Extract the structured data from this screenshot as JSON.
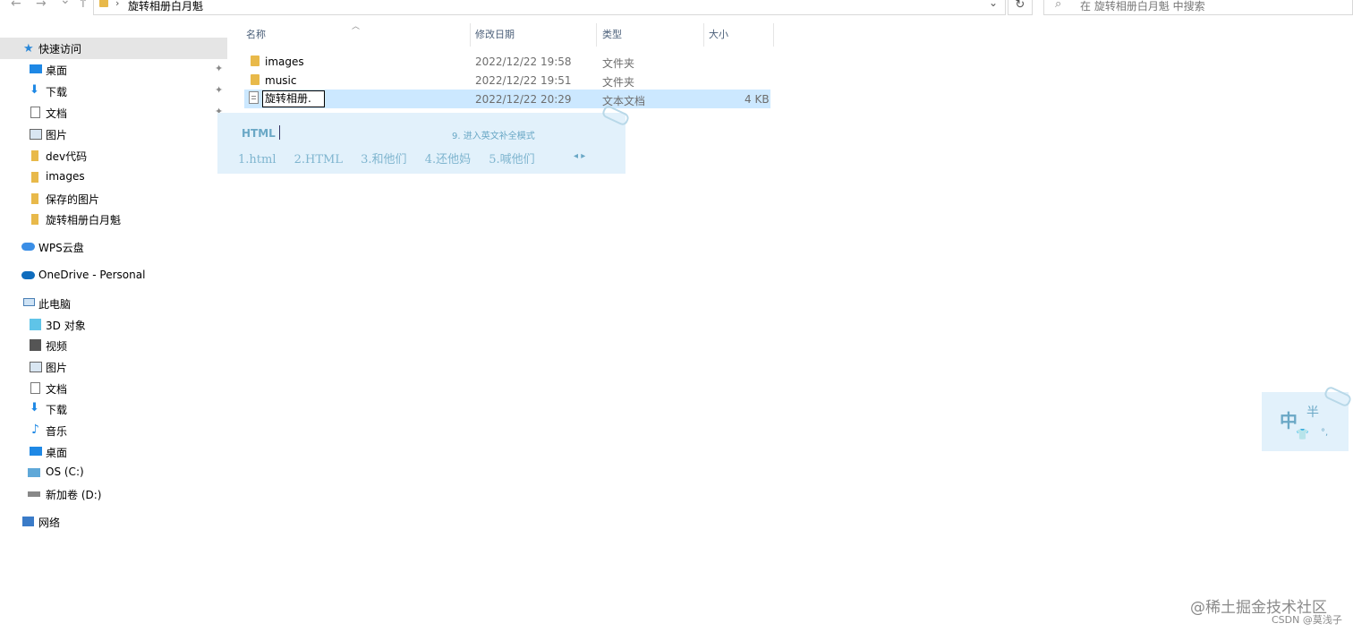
{
  "nav": {
    "back": "←",
    "forward": "→",
    "recent": "⌄",
    "up": "↑"
  },
  "address": {
    "separator": "›",
    "path": "旋转相册白月魁",
    "dropdown": "⌄",
    "refresh": "↻"
  },
  "search": {
    "icon": "search-icon",
    "placeholder": "在 旋转相册白月魁 中搜索"
  },
  "sidebar": {
    "quick_access": {
      "label": "快速访问",
      "items": [
        {
          "label": "桌面",
          "icon": "desktop-icon",
          "pinned": true
        },
        {
          "label": "下载",
          "icon": "download-icon",
          "pinned": true
        },
        {
          "label": "文档",
          "icon": "documents-icon",
          "pinned": true
        },
        {
          "label": "图片",
          "icon": "pictures-icon",
          "pinned": true
        },
        {
          "label": "dev代码",
          "icon": "folder-icon"
        },
        {
          "label": "images",
          "icon": "folder-icon"
        },
        {
          "label": "保存的图片",
          "icon": "folder-icon"
        },
        {
          "label": "旋转相册白月魁",
          "icon": "folder-icon"
        }
      ]
    },
    "wps": {
      "label": "WPS云盘",
      "icon": "cloud-icon"
    },
    "onedrive": {
      "label": "OneDrive - Personal",
      "icon": "onedrive-icon"
    },
    "this_pc": {
      "label": "此电脑",
      "items": [
        {
          "label": "3D 对象",
          "icon": "3d-objects-icon"
        },
        {
          "label": "视频",
          "icon": "videos-icon"
        },
        {
          "label": "图片",
          "icon": "pictures-icon"
        },
        {
          "label": "文档",
          "icon": "documents-icon"
        },
        {
          "label": "下载",
          "icon": "download-icon"
        },
        {
          "label": "音乐",
          "icon": "music-icon"
        },
        {
          "label": "桌面",
          "icon": "desktop-icon"
        },
        {
          "label": "OS (C:)",
          "icon": "drive-c-icon"
        },
        {
          "label": "新加卷 (D:)",
          "icon": "drive-d-icon"
        }
      ]
    },
    "network": {
      "label": "网络",
      "icon": "network-icon"
    },
    "pin_glyph": "📌"
  },
  "columns": {
    "name": "名称",
    "date": "修改日期",
    "type": "类型",
    "size": "大小"
  },
  "files": [
    {
      "name": "images",
      "date": "2022/12/22 19:58",
      "type": "文件夹",
      "size": "",
      "icon": "folder-icon"
    },
    {
      "name": "music",
      "date": "2022/12/22 19:51",
      "type": "文件夹",
      "size": "",
      "icon": "folder-icon"
    },
    {
      "name": "旋转相册.",
      "date": "2022/12/22 20:29",
      "type": "文本文档",
      "size": "4 KB",
      "icon": "text-file-icon",
      "renaming": true
    }
  ],
  "ime": {
    "composition": "HTML",
    "hint": "9. 进入英文补全模式",
    "candidates": [
      "1.html",
      "2.HTML",
      "3.和他们",
      "4.还他妈",
      "5.喊他们"
    ],
    "arrows": "◂ ▸"
  },
  "ime_status": {
    "mode": "中",
    "width": "半",
    "skin": "👕",
    "punct": "°,"
  },
  "watermark": {
    "site": "@稀土掘金技术社区",
    "author": "CSDN @莫浅子"
  },
  "colors": {
    "selection": "#cce8ff",
    "sidebar_selected": "#e5e5e5",
    "folder": "#e8b94a",
    "ime_bg": "#e2f1fb"
  }
}
